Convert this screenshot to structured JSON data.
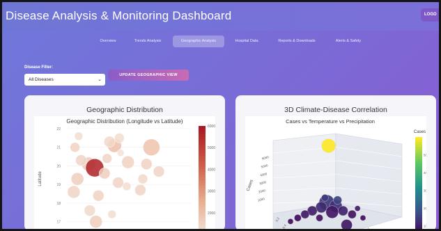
{
  "header": {
    "title": "Disease Analysis & Monitoring Dashboard",
    "logout_label": "LOGO"
  },
  "tabs": [
    {
      "label": "Overview",
      "active": false
    },
    {
      "label": "Trends Analysis",
      "active": false
    },
    {
      "label": "Geographic Analysis",
      "active": true
    },
    {
      "label": "Hospital Data",
      "active": false
    },
    {
      "label": "Reports & Downloads",
      "active": false
    },
    {
      "label": "Alerts & Safety",
      "active": false
    }
  ],
  "filter": {
    "label": "Disease Filter:",
    "selected": "All Diseases",
    "update_label": "UPDATE GEOGRAPHIC VIEW"
  },
  "cards": {
    "left": {
      "title": "Geographic Distribution"
    },
    "right": {
      "title": "3D Climate-Disease Correlation"
    }
  },
  "chart_data": [
    {
      "type": "scatter",
      "title": "Geographic Distribution (Longitude vs Latitude)",
      "ylabel": "Latitude",
      "yticks": [
        "22",
        "21",
        "20",
        "19",
        "18",
        "17"
      ],
      "ylim": [
        16.5,
        22
      ],
      "xlim": [
        0,
        10
      ],
      "colorbar": {
        "ticks": [
          "6000",
          "5000",
          "4000",
          "3000",
          "2000",
          "1000"
        ],
        "range": [
          1000,
          6000
        ]
      },
      "points": [
        {
          "x": 0.6,
          "y": 21.0,
          "v": 1600,
          "s": 7
        },
        {
          "x": 0.9,
          "y": 21.6,
          "v": 1300,
          "s": 6
        },
        {
          "x": 1.7,
          "y": 20.1,
          "v": 1800,
          "s": 10
        },
        {
          "x": 2.2,
          "y": 19.9,
          "v": 5800,
          "s": 13
        },
        {
          "x": 1.1,
          "y": 20.3,
          "v": 1500,
          "s": 8
        },
        {
          "x": 3.8,
          "y": 21.1,
          "v": 2100,
          "s": 10
        },
        {
          "x": 3.4,
          "y": 21.3,
          "v": 1400,
          "s": 8
        },
        {
          "x": 4.2,
          "y": 21.5,
          "v": 1300,
          "s": 7
        },
        {
          "x": 3.2,
          "y": 20.4,
          "v": 1500,
          "s": 7
        },
        {
          "x": 4.9,
          "y": 20.2,
          "v": 1600,
          "s": 9
        },
        {
          "x": 4.3,
          "y": 20.7,
          "v": 1200,
          "s": 5
        },
        {
          "x": 3.0,
          "y": 19.6,
          "v": 1700,
          "s": 8
        },
        {
          "x": 4.1,
          "y": 19.1,
          "v": 1500,
          "s": 8
        },
        {
          "x": 0.8,
          "y": 19.3,
          "v": 1700,
          "s": 9
        },
        {
          "x": 6.8,
          "y": 21.0,
          "v": 2000,
          "s": 12
        },
        {
          "x": 6.4,
          "y": 20.1,
          "v": 1600,
          "s": 8
        },
        {
          "x": 7.4,
          "y": 19.7,
          "v": 1500,
          "s": 8
        },
        {
          "x": 6.1,
          "y": 19.3,
          "v": 1400,
          "s": 7
        },
        {
          "x": 2.5,
          "y": 18.4,
          "v": 1600,
          "s": 8
        },
        {
          "x": 1.8,
          "y": 17.6,
          "v": 1400,
          "s": 8
        },
        {
          "x": 0.5,
          "y": 18.6,
          "v": 1500,
          "s": 9
        },
        {
          "x": 2.3,
          "y": 17.0,
          "v": 1700,
          "s": 9
        },
        {
          "x": 3.6,
          "y": 17.4,
          "v": 1300,
          "s": 6
        },
        {
          "x": 5.9,
          "y": 18.7,
          "v": 1500,
          "s": 8
        },
        {
          "x": 4.8,
          "y": 18.9,
          "v": 1300,
          "s": 6
        }
      ]
    },
    {
      "type": "scatter3d",
      "title": "Cases vs Temperature vs Precipitation",
      "zlabel": "Cases",
      "zticks": [
        "6000",
        "5000",
        "4000",
        "3000",
        "2000",
        "1000"
      ],
      "colorbar": {
        "title": "Cases",
        "ticks": [
          "5000",
          "4000",
          "3000",
          "2000",
          "1000"
        ],
        "range": [
          500,
          6000
        ]
      },
      "points": [
        {
          "px": 0.46,
          "py": 0.25,
          "v": 6000,
          "s": 10
        },
        {
          "px": 0.45,
          "py": 0.73,
          "v": 1400,
          "s": 11
        },
        {
          "px": 0.5,
          "py": 0.76,
          "v": 1300,
          "s": 9
        },
        {
          "px": 0.42,
          "py": 0.77,
          "v": 1200,
          "s": 8
        },
        {
          "px": 0.37,
          "py": 0.8,
          "v": 1000,
          "s": 7
        },
        {
          "px": 0.54,
          "py": 0.8,
          "v": 1100,
          "s": 7
        },
        {
          "px": 0.48,
          "py": 0.81,
          "v": 900,
          "s": 9
        },
        {
          "px": 0.33,
          "py": 0.83,
          "v": 900,
          "s": 6
        },
        {
          "px": 0.59,
          "py": 0.83,
          "v": 800,
          "s": 6
        },
        {
          "px": 0.41,
          "py": 0.86,
          "v": 800,
          "s": 5
        },
        {
          "px": 0.56,
          "py": 0.92,
          "v": 900,
          "s": 8
        },
        {
          "px": 0.29,
          "py": 0.86,
          "v": 700,
          "s": 5
        },
        {
          "px": 0.65,
          "py": 0.86,
          "v": 700,
          "s": 4
        },
        {
          "px": 0.51,
          "py": 0.71,
          "v": 1600,
          "s": 6
        },
        {
          "px": 0.25,
          "py": 0.89,
          "v": 700,
          "s": 4
        },
        {
          "px": 0.62,
          "py": 0.78,
          "v": 1000,
          "s": 4
        },
        {
          "px": 0.44,
          "py": 0.69,
          "v": 1500,
          "s": 5
        }
      ],
      "axis_ticks_z": [
        "6000",
        "5000",
        "4000",
        "3000",
        "2000",
        "1000"
      ],
      "axis_ticks_other": [
        "0.2",
        "0.4",
        "305"
      ]
    }
  ]
}
